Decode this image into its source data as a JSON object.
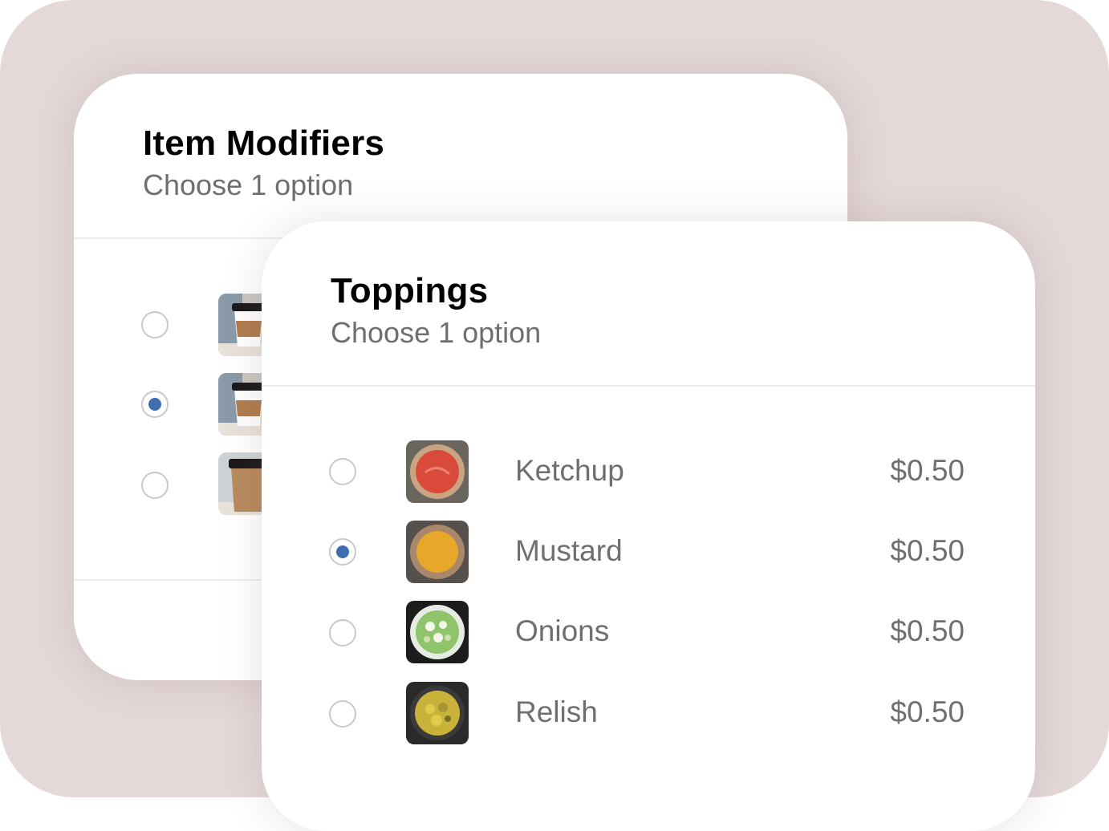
{
  "modifiers_card": {
    "title": "Item Modifiers",
    "subtitle": "Choose 1 option",
    "options": [
      {
        "selected": false,
        "thumb_icon": "coffee-cup-icon"
      },
      {
        "selected": true,
        "thumb_icon": "coffee-cup-icon"
      },
      {
        "selected": false,
        "thumb_icon": "coffee-cup-icon"
      }
    ]
  },
  "toppings_card": {
    "title": "Toppings",
    "subtitle": "Choose 1 option",
    "options": [
      {
        "label": "Ketchup",
        "price": "$0.50",
        "selected": false,
        "thumb_icon": "ketchup-bowl-icon"
      },
      {
        "label": "Mustard",
        "price": "$0.50",
        "selected": true,
        "thumb_icon": "mustard-bowl-icon"
      },
      {
        "label": "Onions",
        "price": "$0.50",
        "selected": false,
        "thumb_icon": "onions-bowl-icon"
      },
      {
        "label": "Relish",
        "price": "$0.50",
        "selected": false,
        "thumb_icon": "relish-bowl-icon"
      }
    ]
  },
  "colors": {
    "backdrop": "#e4d8d8",
    "accent": "#3f6db0",
    "muted_text": "#6f6f6f"
  }
}
